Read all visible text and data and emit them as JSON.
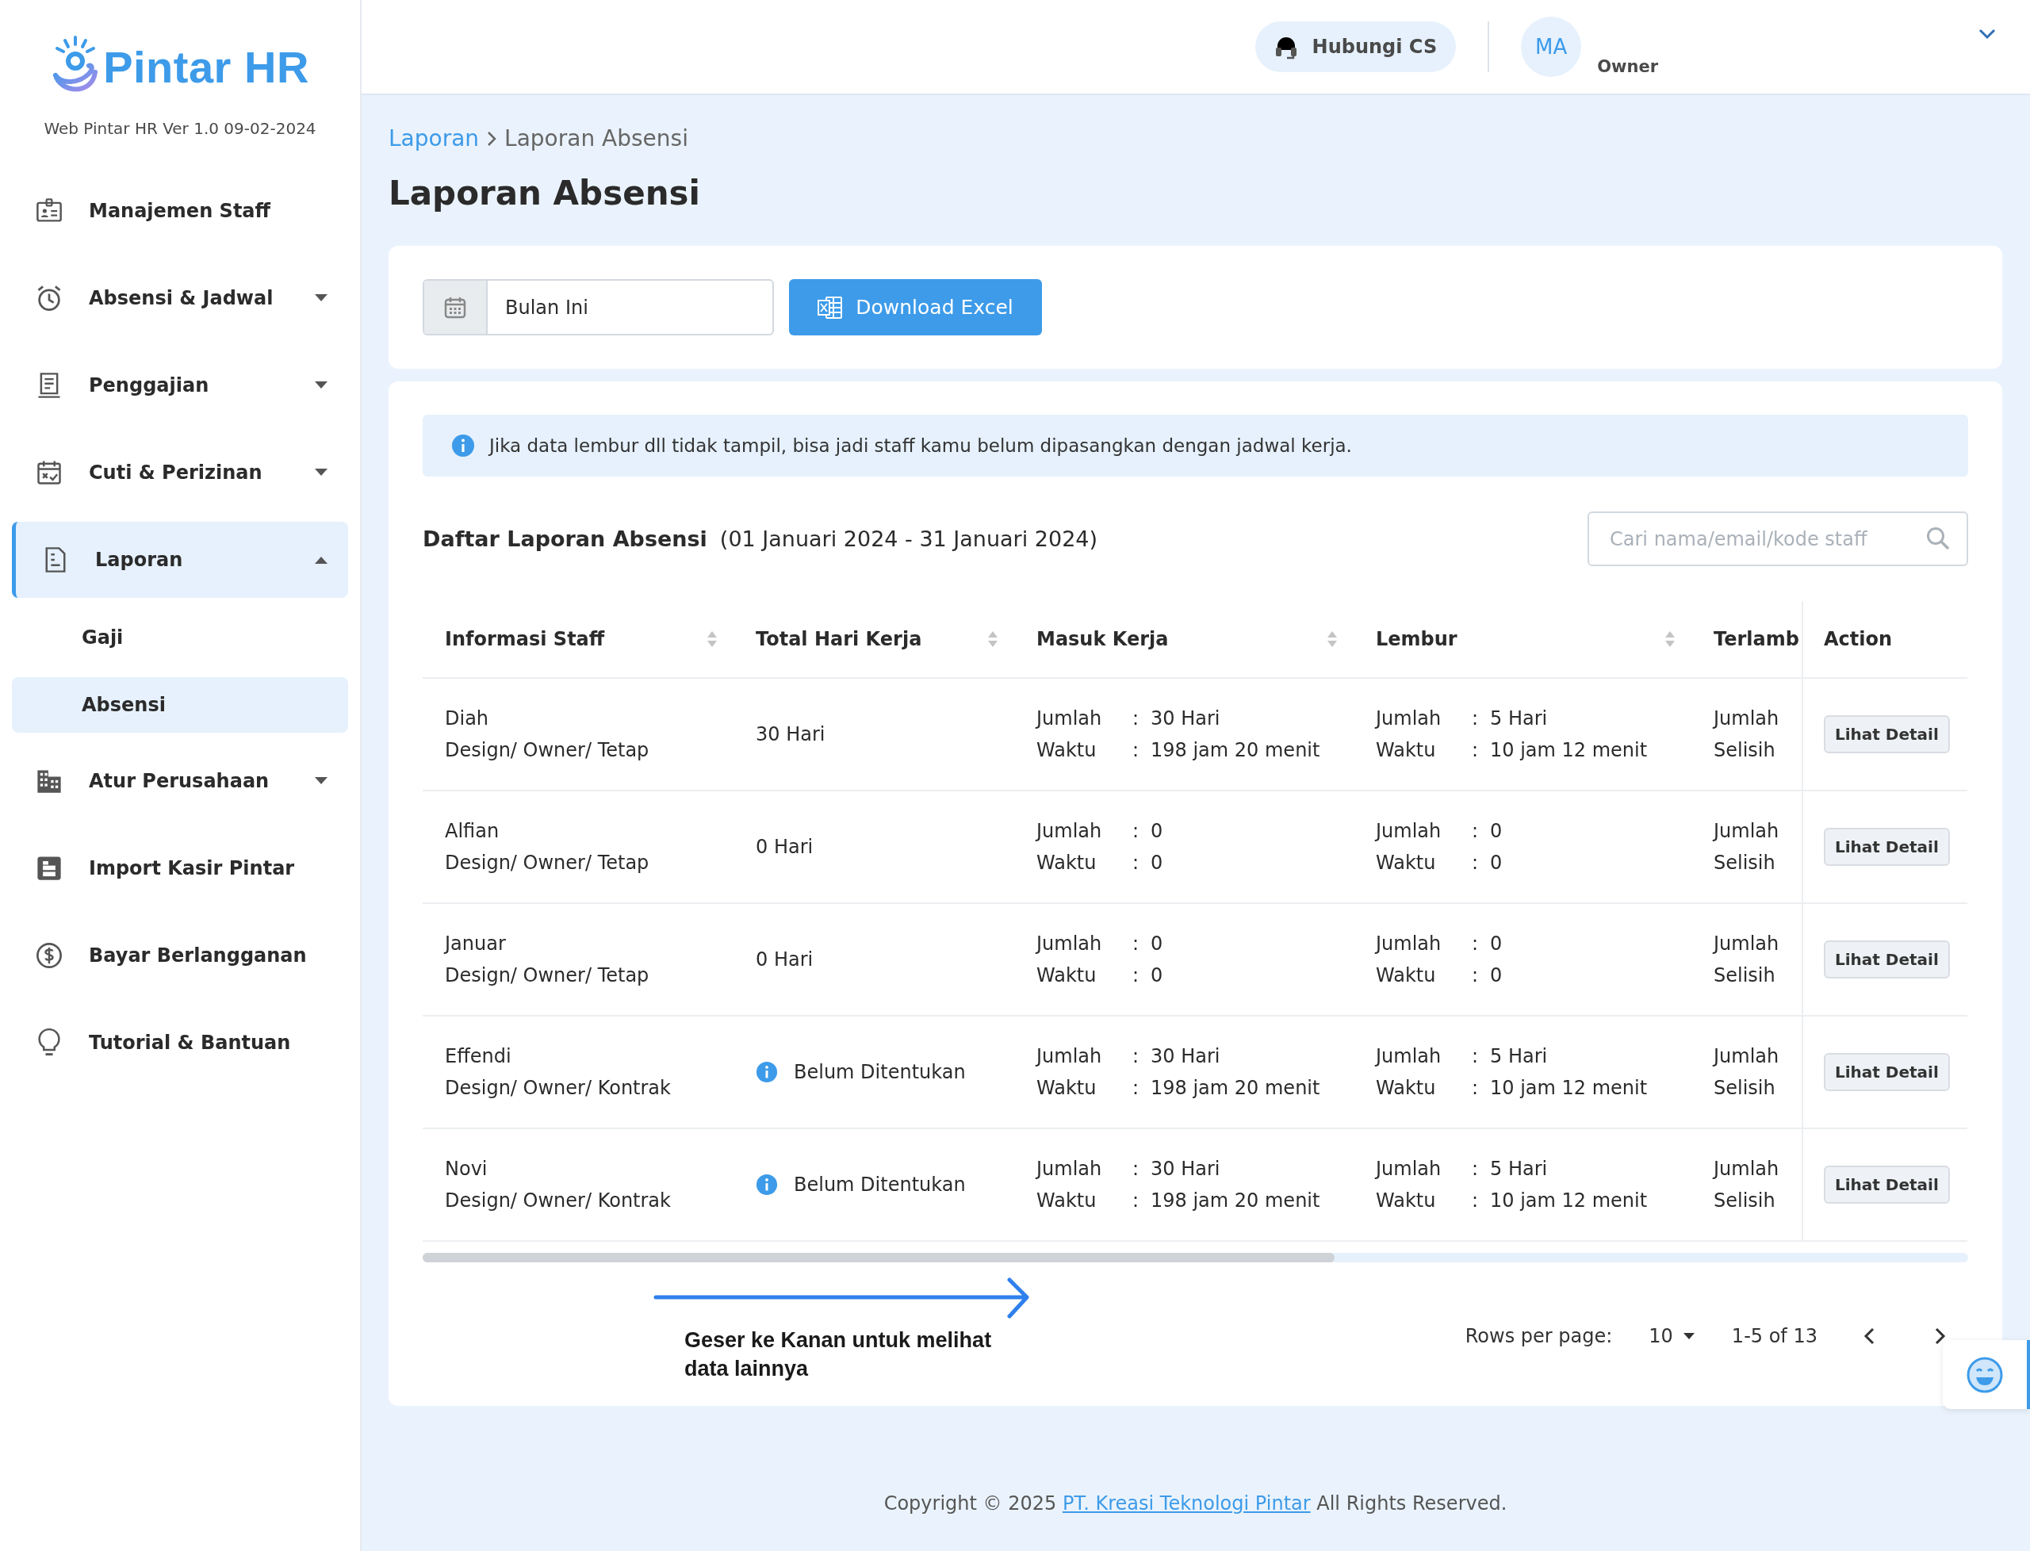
{
  "sidebar": {
    "logo": "Pintar HR",
    "version": "Web Pintar HR Ver 1.0 09-02-2024",
    "items": [
      {
        "label": "Manajemen Staff",
        "selected": false
      },
      {
        "label": "Absensi & Jadwal",
        "selected": false,
        "expanded": false
      },
      {
        "label": "Penggajian",
        "selected": false,
        "expanded": false
      },
      {
        "label": "Cuti & Perizinan",
        "selected": false,
        "expanded": false
      },
      {
        "label": "Laporan",
        "selected": true,
        "expanded": true,
        "children": [
          {
            "label": "Gaji",
            "selected": false
          },
          {
            "label": "Absensi",
            "selected": true
          }
        ]
      },
      {
        "label": "Atur Perusahaan",
        "selected": false,
        "expanded": false
      },
      {
        "label": "Import Kasir Pintar",
        "selected": false
      },
      {
        "label": "Bayar Berlangganan",
        "selected": false
      },
      {
        "label": "Tutorial & Bantuan",
        "selected": false
      }
    ]
  },
  "header": {
    "contact_button": "Hubungi CS",
    "avatar": "MA",
    "role": "Owner"
  },
  "breadcrumb": [
    "Laporan",
    "Laporan Absensi"
  ],
  "title": "Laporan Absensi",
  "filter": {
    "period": "Bulan Ini",
    "download_button": "Download Excel"
  },
  "notice": "Jika data lembur dll tidak tampil, bisa jadi staff kamu belum dipasangkan dengan jadwal kerja.",
  "report": {
    "heading": "Daftar Laporan Absensi",
    "range": "(01 Januari 2024 - 31 Januari 2024)",
    "search": {
      "placeholder": "Cari nama/email/kode staff"
    },
    "table": {
      "columns": [
        {
          "label": "Informasi Staff",
          "sortable": true
        },
        {
          "label": "Total Hari Kerja",
          "sortable": true
        },
        {
          "label": "Masuk Kerja",
          "sortable": true
        },
        {
          "label": "Lembur",
          "sortable": true
        },
        {
          "label": "Terlamb",
          "sortable": false
        },
        {
          "label": "Action",
          "sortable": false
        }
      ],
      "rows": [
        {
          "name": "Diah",
          "position": "Design/ Owner/ Tetap",
          "total": {
            "kind": "days",
            "text": "30 Hari"
          },
          "masuk": [
            {
              "label": "Jumlah",
              "sep": ":",
              "value": "30 Hari"
            },
            {
              "label": "Waktu",
              "sep": ":",
              "value": "198 jam 20 menit"
            }
          ],
          "lembur": [
            {
              "label": "Jumlah",
              "sep": ":",
              "value": "5 Hari"
            },
            {
              "label": "Waktu",
              "sep": ":",
              "value": "10 jam 12 menit"
            }
          ],
          "terlambat": [
            "Jumlah",
            "Selisih"
          ],
          "action": "Lihat Detail"
        },
        {
          "name": "Alfian",
          "position": "Design/ Owner/ Tetap",
          "total": {
            "kind": "days",
            "text": "0 Hari"
          },
          "masuk": [
            {
              "label": "Jumlah",
              "sep": ":",
              "value": "0"
            },
            {
              "label": "Waktu",
              "sep": ":",
              "value": "0"
            }
          ],
          "lembur": [
            {
              "label": "Jumlah",
              "sep": ":",
              "value": "0"
            },
            {
              "label": "Waktu",
              "sep": ":",
              "value": "0"
            }
          ],
          "terlambat": [
            "Jumlah",
            "Selisih"
          ],
          "action": "Lihat Detail"
        },
        {
          "name": "Januar",
          "position": "Design/ Owner/ Tetap",
          "total": {
            "kind": "days",
            "text": "0 Hari"
          },
          "masuk": [
            {
              "label": "Jumlah",
              "sep": ":",
              "value": "0"
            },
            {
              "label": "Waktu",
              "sep": ":",
              "value": "0"
            }
          ],
          "lembur": [
            {
              "label": "Jumlah",
              "sep": ":",
              "value": "0"
            },
            {
              "label": "Waktu",
              "sep": ":",
              "value": "0"
            }
          ],
          "terlambat": [
            "Jumlah",
            "Selisih"
          ],
          "action": "Lihat Detail"
        },
        {
          "name": "Effendi",
          "position": "Design/ Owner/ Kontrak",
          "total": {
            "kind": "unset",
            "text": "Belum Ditentukan"
          },
          "masuk": [
            {
              "label": "Jumlah",
              "sep": ":",
              "value": "30 Hari"
            },
            {
              "label": "Waktu",
              "sep": ":",
              "value": "198 jam 20 menit"
            }
          ],
          "lembur": [
            {
              "label": "Jumlah",
              "sep": ":",
              "value": "5 Hari"
            },
            {
              "label": "Waktu",
              "sep": ":",
              "value": "10 jam 12 menit"
            }
          ],
          "terlambat": [
            "Jumlah",
            "Selisih"
          ],
          "action": "Lihat Detail"
        },
        {
          "name": "Novi",
          "position": "Design/ Owner/ Kontrak",
          "total": {
            "kind": "unset",
            "text": "Belum Ditentukan"
          },
          "masuk": [
            {
              "label": "Jumlah",
              "sep": ":",
              "value": "30 Hari"
            },
            {
              "label": "Waktu",
              "sep": ":",
              "value": "198 jam 20 menit"
            }
          ],
          "lembur": [
            {
              "label": "Jumlah",
              "sep": ":",
              "value": "5 Hari"
            },
            {
              "label": "Waktu",
              "sep": ":",
              "value": "10 jam 12 menit"
            }
          ],
          "terlambat": [
            "Jumlah",
            "Selisih"
          ],
          "action": "Lihat Detail"
        }
      ]
    }
  },
  "hint": "Geser ke Kanan untuk melihat data lainnya",
  "pagination": {
    "rows_label": "Rows per page:",
    "rows_value": "10",
    "range": "1-5 of 13"
  },
  "footer": {
    "prefix": "Copyright © 2025",
    "link": "PT. Kreasi Teknologi Pintar",
    "suffix": "All Rights Reserved."
  }
}
